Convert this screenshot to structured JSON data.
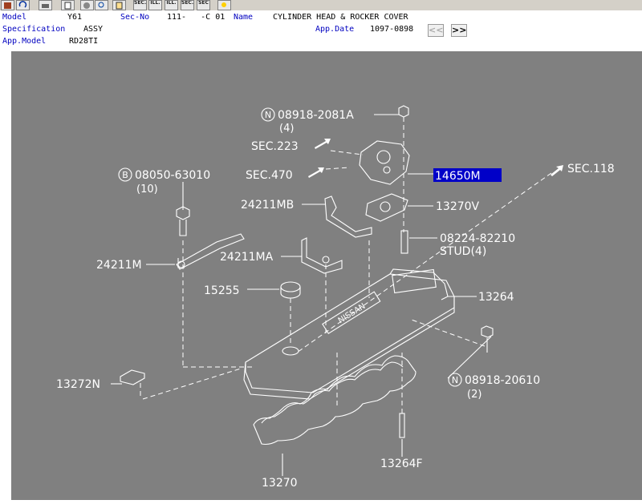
{
  "toolbar": {
    "icons": [
      "book-icon",
      "undo-icon",
      "print-icon",
      "list-icon",
      "circle-icon",
      "zoom-icon",
      "page-icon",
      "sec-ill-icon",
      "ill-icon",
      "ill-icon-2",
      "sec-icon",
      "sec-icon-2",
      "bulb-icon"
    ],
    "labels": [
      "",
      "",
      "",
      "",
      "",
      "",
      "",
      "SEC.",
      "ILL.",
      "ILL.",
      "SEC.",
      "SEC",
      ""
    ]
  },
  "header": {
    "model_label": "Model",
    "model_value": "Y61",
    "secno_label": "Sec-No",
    "secno_value": "111-   -C 01",
    "name_label": "Name",
    "name_value": "CYLINDER HEAD & ROCKER COVER",
    "spec_label": "Specification",
    "spec_value": "ASSY",
    "appdate_label": "App.Date",
    "appdate_value": "1097-0898",
    "appmodel_label": "App.Model",
    "appmodel_value": "RD28TI",
    "prev_label": "<<",
    "next_label": ">>"
  },
  "diagram": {
    "p_08918_2081A": "08918-2081A",
    "p_08918_2081A_qty": "(4)",
    "n_badge_1": "N",
    "sec223": "SEC.223",
    "sec470": "SEC.470",
    "p_14650M": "14650M",
    "sec118": "SEC.118",
    "b_badge": "B",
    "p_08050_63010": "08050-63010",
    "p_08050_63010_qty": "(10)",
    "p_24211MB": "24211MB",
    "p_13270V": "13270V",
    "p_08224_82210": "08224-82210",
    "stud": "STUD(4)",
    "p_24211M": "24211M",
    "p_24211MA": "24211MA",
    "p_15255": "15255",
    "p_13264": "13264",
    "p_13272N": "13272N",
    "n_badge_2": "N",
    "p_08918_20610": "08918-20610",
    "p_08918_20610_qty": "(2)",
    "p_13264F": "13264F",
    "p_13270": "13270",
    "cover_brand": "NISSAN"
  },
  "colors": {
    "canvas": "#808080",
    "highlight": "#0000c8",
    "label_blue": "#0000c0"
  }
}
